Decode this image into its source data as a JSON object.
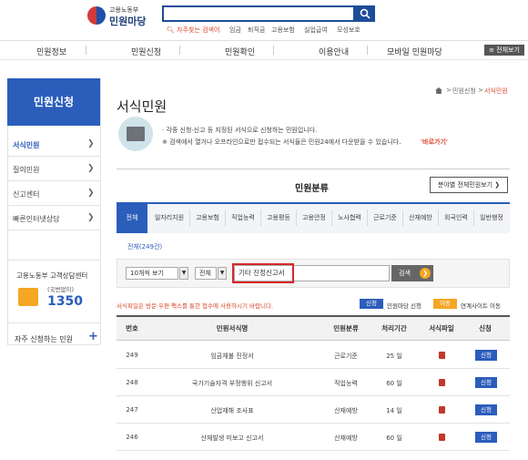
{
  "header": {
    "logo_small": "고용노동부",
    "logo_big": "민원마당",
    "search_value": "",
    "freq_label": "자주찾는 검색어",
    "keywords": [
      "임금",
      "퇴직금",
      "고용보험",
      "실업급여",
      "모성보호"
    ]
  },
  "nav": {
    "items": [
      "민원정보",
      "민원신청",
      "민원확인",
      "이용안내",
      "모바일 민원마당"
    ],
    "all_menu": "전체보기"
  },
  "sidebar": {
    "title": "민원신청",
    "items": [
      {
        "label": "서식민원",
        "active": true
      },
      {
        "label": "질의민원",
        "active": false
      },
      {
        "label": "신고센터",
        "active": false
      },
      {
        "label": "빠른인터넷상담",
        "active": false
      }
    ],
    "callcenter": {
      "title": "고용노동부 고객상담센터",
      "sub": "(국번없이)",
      "number": "1350"
    },
    "faq": "자주 신청하는 민원"
  },
  "breadcrumb": [
    "민원신청",
    "서식민원"
  ],
  "page": {
    "title": "서식민원",
    "desc1": "· 각종 신청·신고 등 지정된 서식으로 신청하는 민원입니다.",
    "desc2": "※ 검색에서 열거나 오프라인으로만 접수되는 서식들은 민원24에서 다운받을 수 있습니다.",
    "go_link": "'바로가기'",
    "section_title": "민원분류",
    "view_all": "분야별 전체민원보기",
    "categories": [
      "전체",
      "일자리지원",
      "고용보험",
      "직업능력",
      "고용평등",
      "고용안정",
      "노사협력",
      "근로기준",
      "산재예방",
      "외국인력",
      "일반행정"
    ],
    "count_link": "전체(249건)"
  },
  "filter": {
    "page_size": "10개씩 보기",
    "scope": "전체",
    "keyword": "기타 진정신고서",
    "search_label": "검색"
  },
  "notice": "서식파일은 방문·우편·팩스를 통한 접수에 사용하시기 바랍니다.",
  "legend": {
    "blue_label": "신청",
    "blue_text": "민원마당 신청",
    "yellow_label": "이동",
    "yellow_text": "연계사이트 이동"
  },
  "table": {
    "headers": [
      "번호",
      "민원서식명",
      "민원분류",
      "처리기간",
      "서식파일",
      "신청"
    ],
    "rows": [
      {
        "no": "249",
        "name": "임금체불 진정서",
        "cat": "근로기준",
        "period": "25 일",
        "apply": "신청"
      },
      {
        "no": "248",
        "name": "국가기술자격 부정행위 신고서",
        "cat": "직업능력",
        "period": "60 일",
        "apply": "신청"
      },
      {
        "no": "247",
        "name": "산업재해 조사표",
        "cat": "산재예방",
        "period": "14 일",
        "apply": "신청"
      },
      {
        "no": "246",
        "name": "산재발생 미보고 신고서",
        "cat": "산재예방",
        "period": "60 일",
        "apply": "신청"
      }
    ]
  },
  "colors": {
    "primary": "#2b5dbb",
    "accent": "#d9472b",
    "yellow": "#f5a623"
  }
}
